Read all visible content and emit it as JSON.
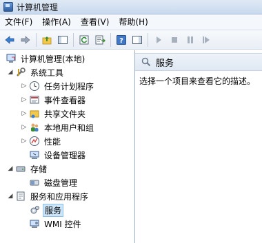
{
  "window": {
    "title": "计算机管理"
  },
  "menubar": {
    "items": [
      {
        "label": "文件(F)"
      },
      {
        "label": "操作(A)"
      },
      {
        "label": "查看(V)"
      },
      {
        "label": "帮助(H)"
      }
    ]
  },
  "tree": {
    "root": "计算机管理(本地)",
    "system_tools": "系统工具",
    "task_scheduler": "任务计划程序",
    "event_viewer": "事件查看器",
    "shared_folders": "共享文件夹",
    "local_users": "本地用户和组",
    "performance": "性能",
    "device_manager": "设备管理器",
    "storage": "存储",
    "disk_management": "磁盘管理",
    "services_apps": "服务和应用程序",
    "services": "服务",
    "wmi": "WMI 控件"
  },
  "detail": {
    "header": "服务",
    "description": "选择一个项目来查看它的描述。"
  },
  "colors": {
    "selection": "#cce4f7",
    "header_bg": "#e6edf6"
  }
}
